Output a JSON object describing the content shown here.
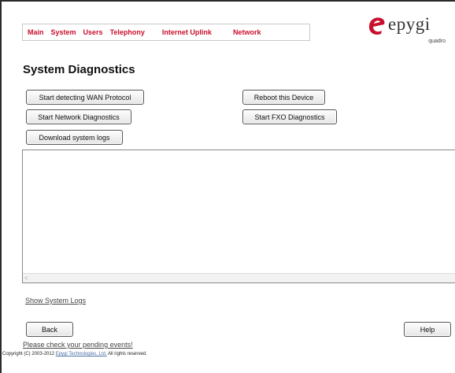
{
  "nav": {
    "items": [
      "Main",
      "System",
      "Users",
      "Telephony",
      "Internet Uplink",
      "Network"
    ]
  },
  "logo": {
    "text": "epygi",
    "sub": "quadro"
  },
  "page": {
    "title": "System Diagnostics"
  },
  "buttons": {
    "wan": "Start detecting WAN Protocol",
    "reboot": "Reboot this Device",
    "network": "Start Network Diagnostics",
    "fxo": "Start FXO Diagnostics",
    "download": "Download system logs",
    "back": "Back",
    "help": "Help"
  },
  "links": {
    "show_logs": "Show System Logs",
    "pending": "Please check your pending events!"
  },
  "footer": {
    "copyright_prefix": "Copyright (C) 2003-2012 ",
    "company": "Epygi Technologies, Ltd.",
    "copyright_suffix": " All rights reserved."
  },
  "colors": {
    "nav": "#c8102e",
    "logo_accent": "#c8102e"
  }
}
